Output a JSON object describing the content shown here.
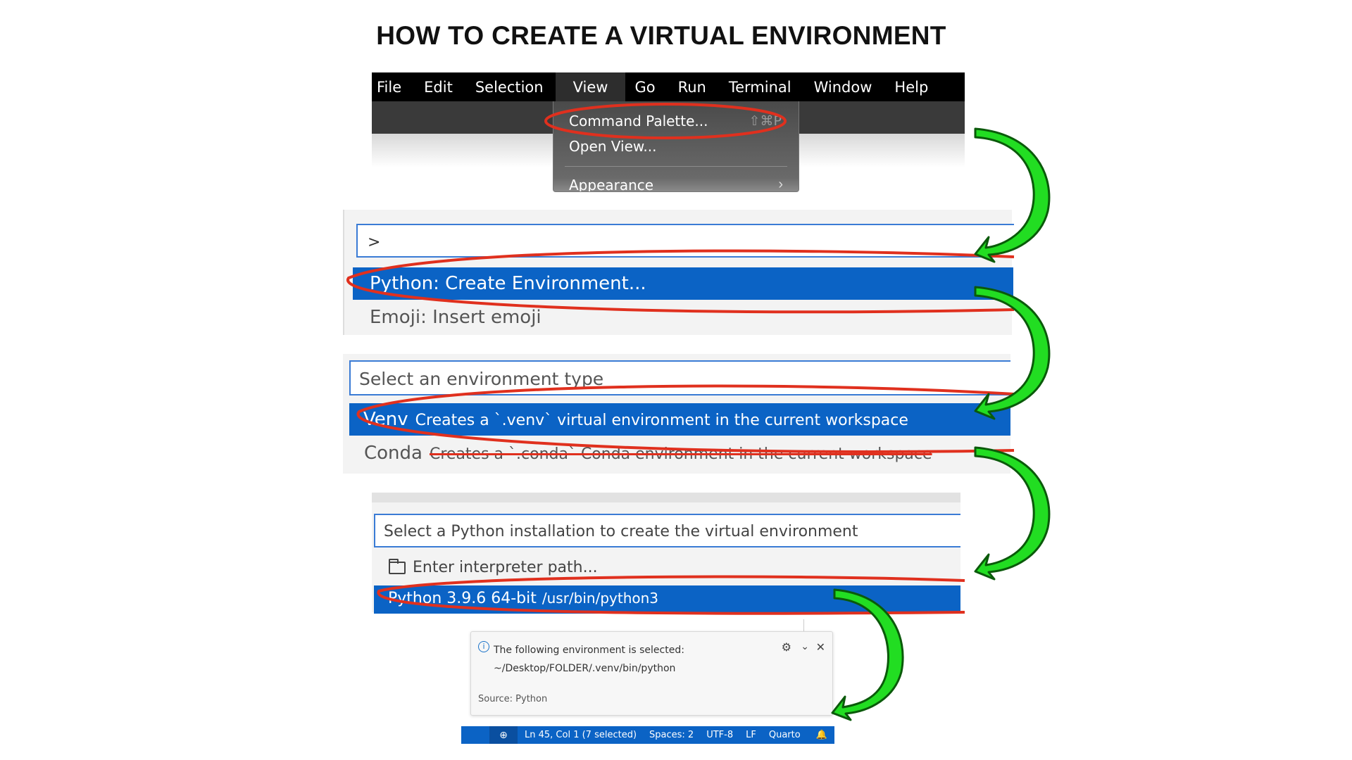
{
  "title": "HOW TO CREATE A VIRTUAL ENVIRONMENT",
  "menubar": {
    "items": [
      "File",
      "Edit",
      "Selection",
      "View",
      "Go",
      "Run",
      "Terminal",
      "Window",
      "Help"
    ],
    "active": "View"
  },
  "view_menu": {
    "command_palette": "Command Palette...",
    "command_palette_shortcut": "⇧⌘P",
    "open_view": "Open View...",
    "appearance": "Appearance"
  },
  "command_palette": {
    "input_value": ">",
    "selected_item": "Python: Create Environment...",
    "next_item": "Emoji: Insert emoji"
  },
  "env_type": {
    "placeholder": "Select an environment type",
    "venv_name": "Venv",
    "venv_desc": "Creates a `.venv` virtual environment in the current workspace",
    "conda_name": "Conda",
    "conda_desc": "Creates a `.conda` Conda environment in the current workspace"
  },
  "interpreter": {
    "placeholder": "Select a Python installation to create the virtual environment",
    "enter_path": "Enter interpreter path...",
    "selected_name": "Python 3.9.6 64-bit",
    "selected_path": "/usr/bin/python3"
  },
  "notification": {
    "line1": "The following environment is selected:",
    "line2": "~/Desktop/FOLDER/.venv/bin/python",
    "source": "Source: Python"
  },
  "statusbar": {
    "position": "Ln 45, Col 1 (7 selected)",
    "spaces": "Spaces: 2",
    "encoding": "UTF-8",
    "eol": "LF",
    "language": "Quarto"
  },
  "colors": {
    "selection": "#0b63c5",
    "highlight_ellipse": "#e0301e",
    "arrow_fill": "#22dd22",
    "arrow_outline": "#0a5a0a"
  },
  "icons": [
    "info-icon",
    "gear-icon",
    "chevron-down-icon",
    "close-icon",
    "folder-icon",
    "zoom-icon",
    "bell-icon",
    "chevron-right-icon"
  ]
}
